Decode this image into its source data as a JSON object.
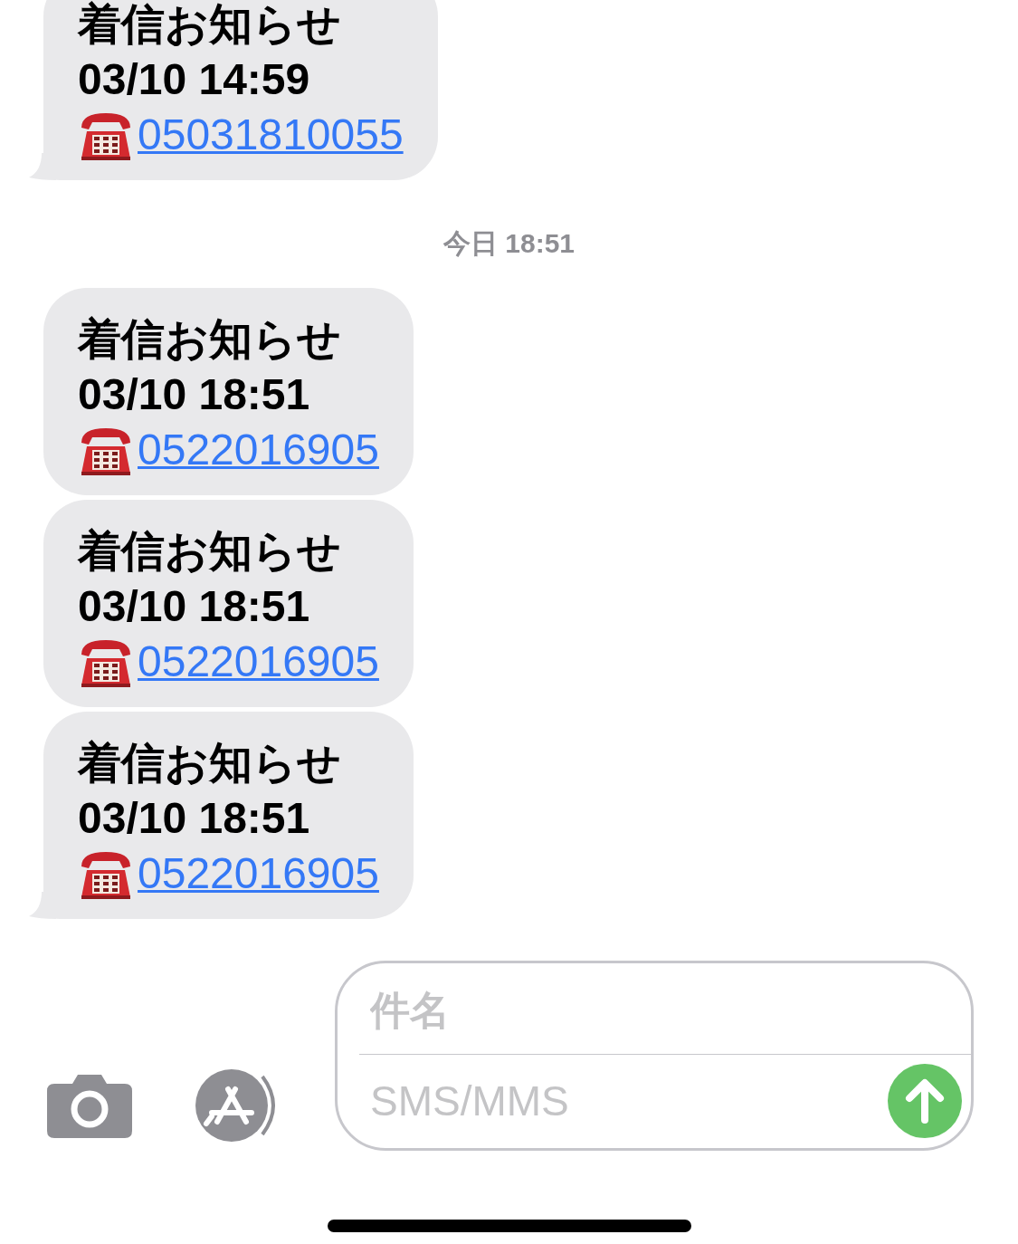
{
  "thread": [
    {
      "kind": "bubble",
      "tail": true,
      "title": "着信お知らせ",
      "datetime": "03/10 14:59",
      "phone": "05031810055"
    },
    {
      "kind": "timestamp",
      "text": "今日 18:51"
    },
    {
      "kind": "bubble",
      "tail": false,
      "title": "着信お知らせ",
      "datetime": "03/10 18:51",
      "phone": "0522016905"
    },
    {
      "kind": "bubble",
      "tail": false,
      "title": "着信お知らせ",
      "datetime": "03/10 18:51",
      "phone": "0522016905"
    },
    {
      "kind": "bubble",
      "tail": true,
      "title": "着信お知らせ",
      "datetime": "03/10 18:51",
      "phone": "0522016905"
    }
  ],
  "composer": {
    "subject": {
      "placeholder": "件名"
    },
    "body": {
      "placeholder": "SMS/MMS"
    }
  }
}
